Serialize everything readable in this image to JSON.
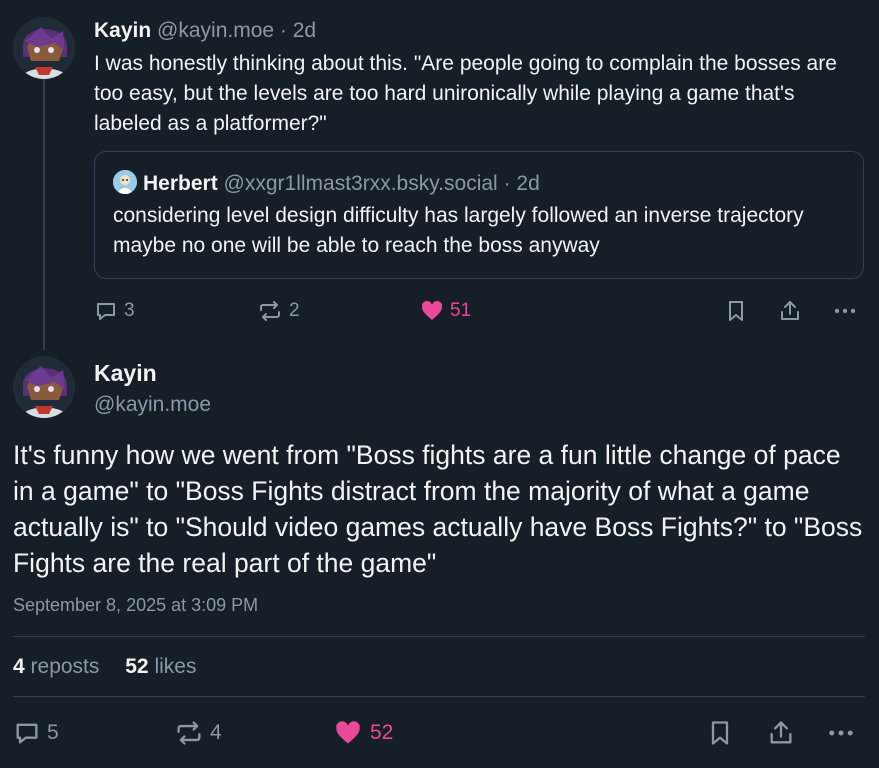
{
  "reply_post": {
    "author_name": "Kayin",
    "author_handle": "@kayin.moe",
    "age": "· 2d",
    "text": "I was honestly thinking about this. \"Are people going to complain the bosses are too easy, but the levels are too hard unironically while playing a game that's labeled as a platformer?\"",
    "quote": {
      "author_name": "Herbert",
      "author_handle": "@xxgr1llmast3rxx.bsky.social",
      "age": "· 2d",
      "text": "considering level design difficulty has largely followed an inverse trajectory maybe no one will be able to reach the boss anyway"
    },
    "actions": {
      "replies": "3",
      "reposts": "2",
      "likes": "51"
    }
  },
  "main_post": {
    "author_name": "Kayin",
    "author_handle": "@kayin.moe",
    "text": "It's funny how we went from \"Boss fights are a fun little change of pace in a game\" to \"Boss Fights distract from the majority of what a game actually is\" to \"Should video games actually have Boss Fights?\" to \"Boss Fights are the real part of the game\"",
    "timestamp": "September 8, 2025 at 3:09 PM",
    "stats": {
      "reposts_count": "4",
      "reposts_label": "reposts",
      "likes_count": "52",
      "likes_label": "likes"
    },
    "actions": {
      "replies": "5",
      "reposts": "4",
      "likes": "52"
    }
  },
  "colors": {
    "background": "#161e27",
    "text": "#f1f3f5",
    "muted": "#8b98a5",
    "like": "#ec4899",
    "border": "#2e4052"
  },
  "icons": [
    "avatar",
    "reply-icon",
    "repost-icon",
    "heart-icon",
    "bookmark-icon",
    "share-icon",
    "more-icon"
  ]
}
